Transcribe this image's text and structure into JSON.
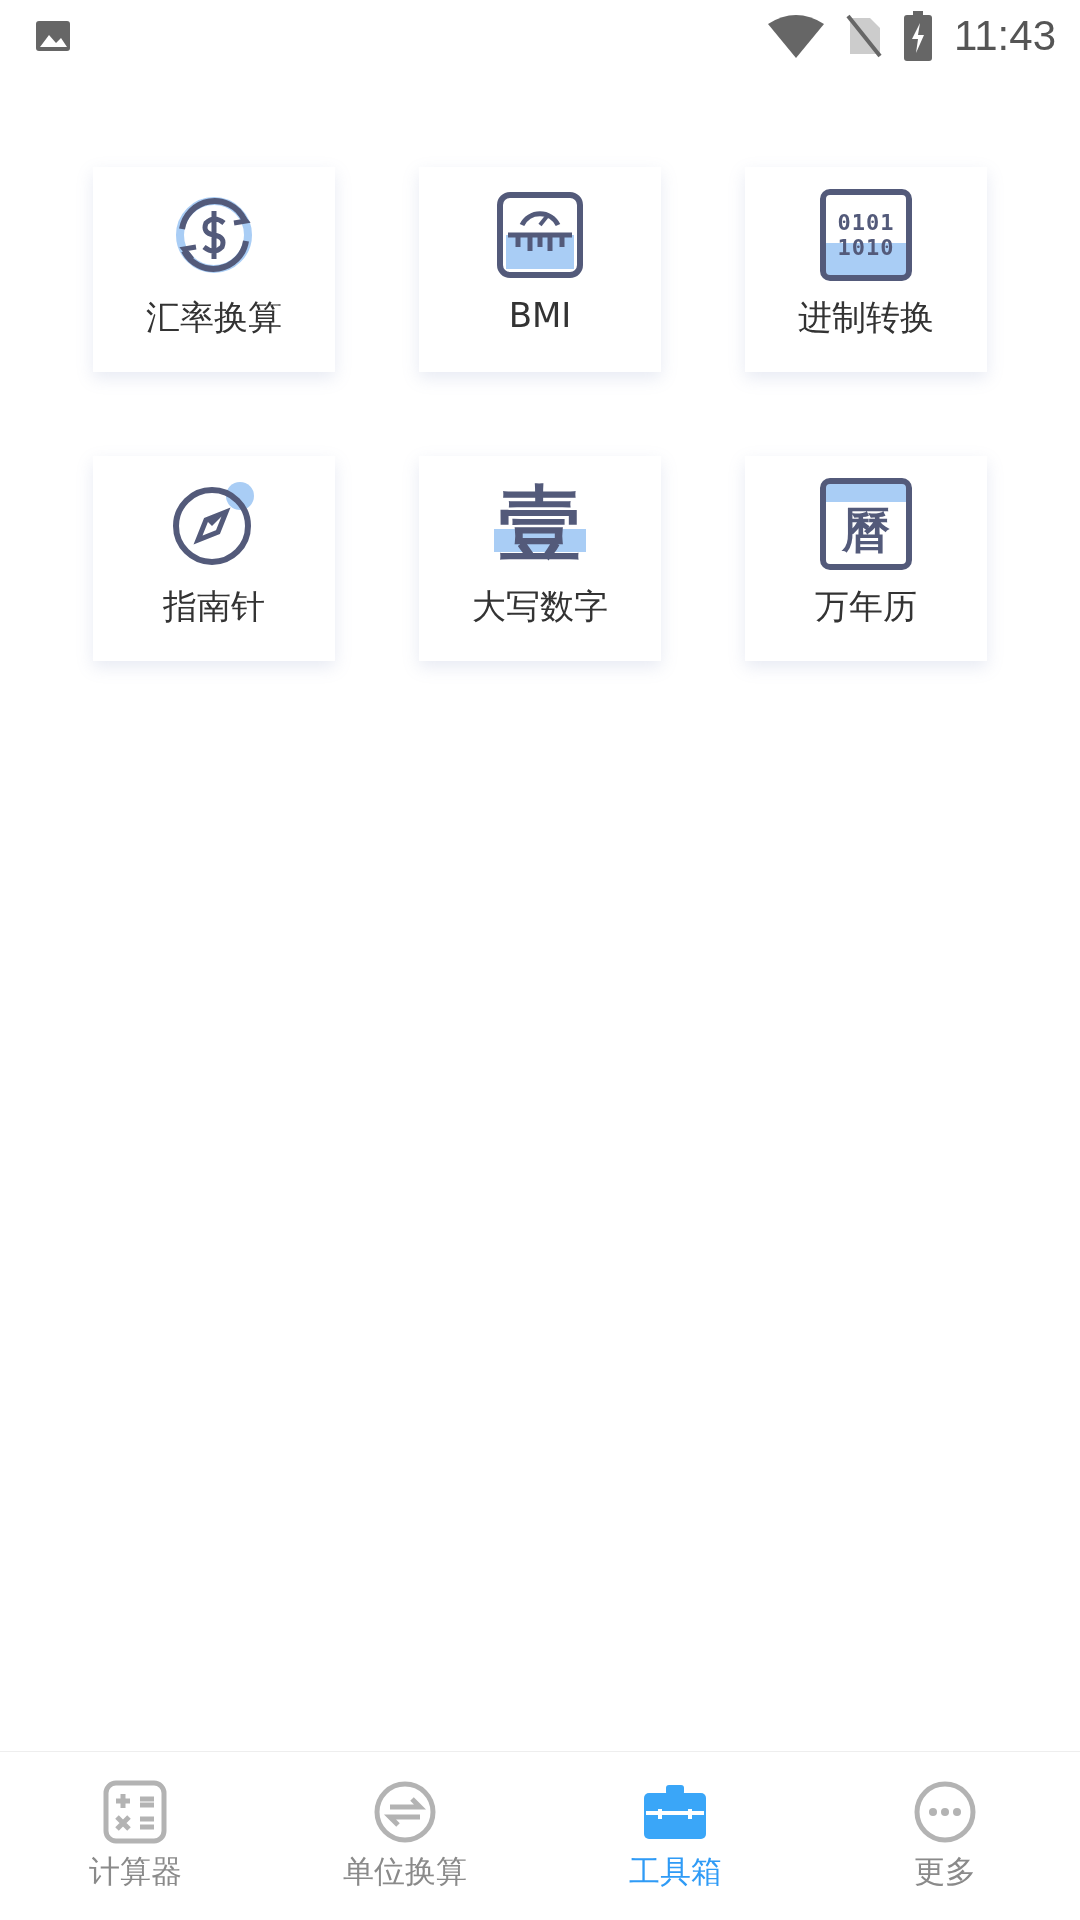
{
  "status_bar": {
    "time": "11:43"
  },
  "tools": [
    {
      "kind": "currency",
      "label": "汇率换算"
    },
    {
      "kind": "bmi",
      "label": "BMI"
    },
    {
      "kind": "binary",
      "label": "进制转换",
      "glyphs": [
        "0101",
        "1010"
      ]
    },
    {
      "kind": "compass",
      "label": "指南针"
    },
    {
      "kind": "capital",
      "label": "大写数字",
      "glyphs": [
        "壹"
      ]
    },
    {
      "kind": "calendar",
      "label": "万年历",
      "glyphs": [
        "曆"
      ]
    }
  ],
  "tabs": [
    {
      "kind": "calculator",
      "label": "计算器",
      "selected": false
    },
    {
      "kind": "convert",
      "label": "单位换算",
      "selected": false
    },
    {
      "kind": "toolbox",
      "label": "工具箱",
      "selected": true
    },
    {
      "kind": "more",
      "label": "更多",
      "selected": false
    }
  ]
}
